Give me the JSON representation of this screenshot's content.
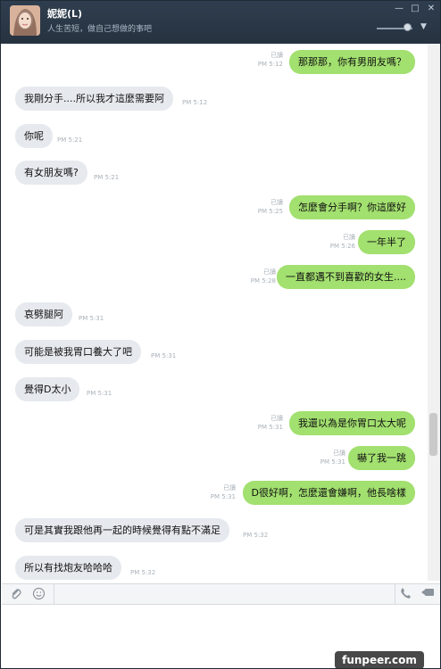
{
  "header": {
    "name": "妮妮(L)",
    "status": "人生苦短，做自己想做的事吧"
  },
  "messages": [
    {
      "dir": "out",
      "text": "那那那，你有男朋友嗎？",
      "read": "已讀",
      "time": "PM 5:12"
    },
    {
      "dir": "in",
      "text": "我剛分手....所以我才這麼需要阿",
      "time": "PM 5:12"
    },
    {
      "dir": "in",
      "text": "你呢",
      "time": "PM 5:21"
    },
    {
      "dir": "in",
      "text": "有女朋友嗎?",
      "time": "PM 5:21"
    },
    {
      "dir": "out",
      "text": "怎麼會分手啊？你這麼好",
      "read": "已讀",
      "time": "PM 5:25"
    },
    {
      "dir": "out",
      "text": "一年半了",
      "read": "已讀",
      "time": "PM 5:26"
    },
    {
      "dir": "out",
      "text": "一直都遇不到喜歡的女生....",
      "read": "已讀",
      "time": "PM 5:28"
    },
    {
      "dir": "in",
      "text": "哀劈腿阿",
      "time": "PM 5:31"
    },
    {
      "dir": "in",
      "text": "可能是被我胃口養大了吧",
      "time": "PM 5:31"
    },
    {
      "dir": "in",
      "text": "覺得D太小",
      "time": "PM 5:31"
    },
    {
      "dir": "out",
      "text": "我還以為是你胃口太大呢",
      "read": "已讀",
      "time": "PM 5:31"
    },
    {
      "dir": "out",
      "text": "嚇了我一跳",
      "read": "已讀",
      "time": "PM 5:31"
    },
    {
      "dir": "out",
      "text": "D很好啊，怎麼還會嫌啊，他長啥樣",
      "read": "已讀",
      "time": "PM 5:31"
    },
    {
      "dir": "in",
      "text": "可是其實我跟他再一起的時候覺得有點不滿足",
      "time": "PM 5:32"
    },
    {
      "dir": "in",
      "text": "所以有找炮友哈哈哈",
      "time": "PM 5:32"
    }
  ],
  "toolbar": {
    "attach_icon": "paperclip-icon",
    "emoji_icon": "smiley-icon",
    "call_icon": "phone-icon",
    "video_icon": "video-icon"
  },
  "colors": {
    "outgoing_bubble": "#a2e06f",
    "incoming_bubble": "#e6e9ee",
    "titlebar": "#2a3746"
  },
  "watermark": "funpeer.com"
}
